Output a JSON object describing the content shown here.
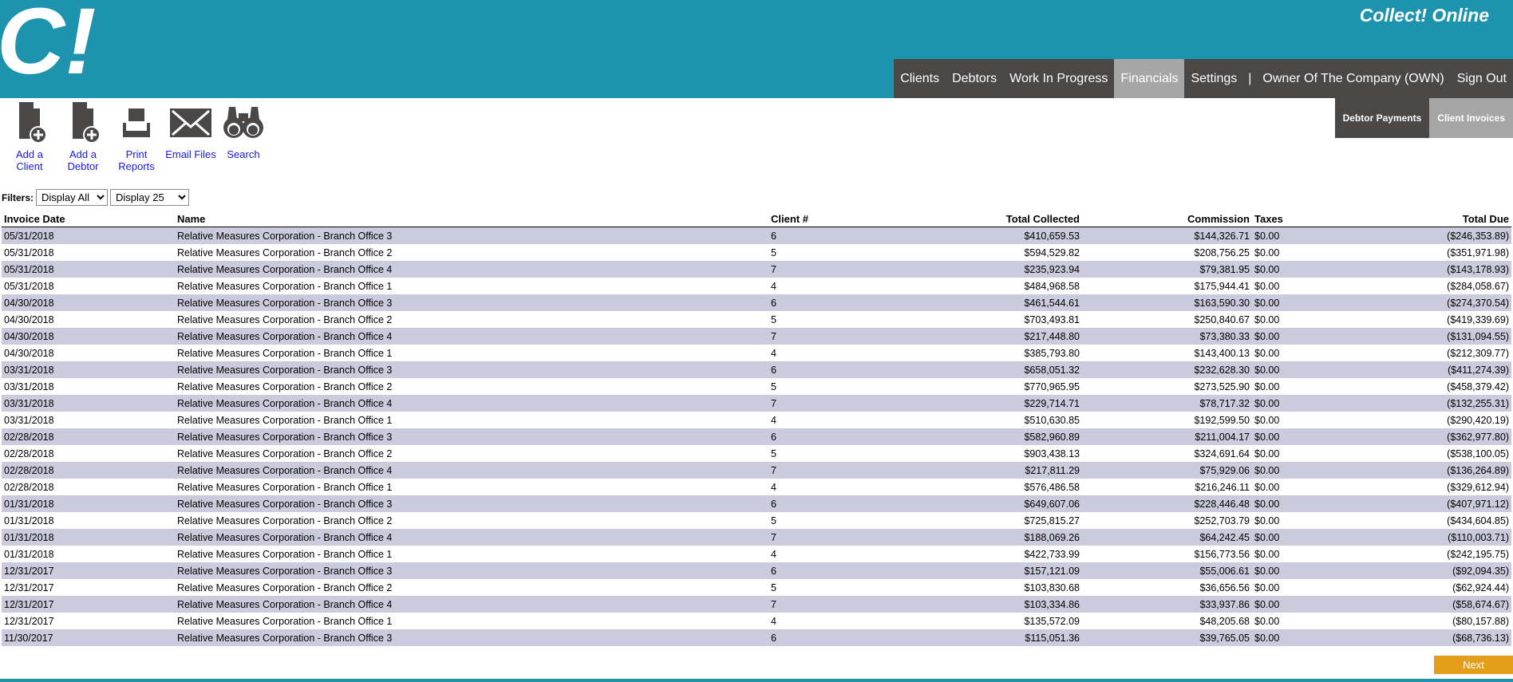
{
  "header": {
    "logo_text": "C!",
    "brand": "Collect! Online",
    "nav": [
      "Clients",
      "Debtors",
      "Work In Progress",
      "Financials",
      "Settings"
    ],
    "nav_separator": "|",
    "user": "Owner Of The Company (OWN)",
    "sign_out": "Sign Out",
    "active_nav": "Financials"
  },
  "toolbar": {
    "add_client": "Add a Client",
    "add_debtor": "Add a Debtor",
    "print_reports": "Print Reports",
    "email_files": "Email Files",
    "search": "Search"
  },
  "subnav": {
    "debtor_payments": "Debtor Payments",
    "client_invoices": "Client Invoices"
  },
  "filters": {
    "label": "Filters:",
    "display_filter": "Display All",
    "page_size": "Display 25"
  },
  "table": {
    "columns": [
      "Invoice Date",
      "Name",
      "Client #",
      "Total Collected",
      "Commission",
      "Taxes",
      "Total Due"
    ],
    "rows": [
      [
        "05/31/2018",
        "Relative Measures Corporation - Branch Office 3",
        "6",
        "$410,659.53",
        "$144,326.71",
        "$0.00",
        "($246,353.89)"
      ],
      [
        "05/31/2018",
        "Relative Measures Corporation - Branch Office 2",
        "5",
        "$594,529.82",
        "$208,756.25",
        "$0.00",
        "($351,971.98)"
      ],
      [
        "05/31/2018",
        "Relative Measures Corporation - Branch Office 4",
        "7",
        "$235,923.94",
        "$79,381.95",
        "$0.00",
        "($143,178.93)"
      ],
      [
        "05/31/2018",
        "Relative Measures Corporation - Branch Office 1",
        "4",
        "$484,968.58",
        "$175,944.41",
        "$0.00",
        "($284,058.67)"
      ],
      [
        "04/30/2018",
        "Relative Measures Corporation - Branch Office 3",
        "6",
        "$461,544.61",
        "$163,590.30",
        "$0.00",
        "($274,370.54)"
      ],
      [
        "04/30/2018",
        "Relative Measures Corporation - Branch Office 2",
        "5",
        "$703,493.81",
        "$250,840.67",
        "$0.00",
        "($419,339.69)"
      ],
      [
        "04/30/2018",
        "Relative Measures Corporation - Branch Office 4",
        "7",
        "$217,448.80",
        "$73,380.33",
        "$0.00",
        "($131,094.55)"
      ],
      [
        "04/30/2018",
        "Relative Measures Corporation - Branch Office 1",
        "4",
        "$385,793.80",
        "$143,400.13",
        "$0.00",
        "($212,309.77)"
      ],
      [
        "03/31/2018",
        "Relative Measures Corporation - Branch Office 3",
        "6",
        "$658,051.32",
        "$232,628.30",
        "$0.00",
        "($411,274.39)"
      ],
      [
        "03/31/2018",
        "Relative Measures Corporation - Branch Office 2",
        "5",
        "$770,965.95",
        "$273,525.90",
        "$0.00",
        "($458,379.42)"
      ],
      [
        "03/31/2018",
        "Relative Measures Corporation - Branch Office 4",
        "7",
        "$229,714.71",
        "$78,717.32",
        "$0.00",
        "($132,255.31)"
      ],
      [
        "03/31/2018",
        "Relative Measures Corporation - Branch Office 1",
        "4",
        "$510,630.85",
        "$192,599.50",
        "$0.00",
        "($290,420.19)"
      ],
      [
        "02/28/2018",
        "Relative Measures Corporation - Branch Office 3",
        "6",
        "$582,960.89",
        "$211,004.17",
        "$0.00",
        "($362,977.80)"
      ],
      [
        "02/28/2018",
        "Relative Measures Corporation - Branch Office 2",
        "5",
        "$903,438.13",
        "$324,691.64",
        "$0.00",
        "($538,100.05)"
      ],
      [
        "02/28/2018",
        "Relative Measures Corporation - Branch Office 4",
        "7",
        "$217,811.29",
        "$75,929.06",
        "$0.00",
        "($136,264.89)"
      ],
      [
        "02/28/2018",
        "Relative Measures Corporation - Branch Office 1",
        "4",
        "$576,486.58",
        "$216,246.11",
        "$0.00",
        "($329,612.94)"
      ],
      [
        "01/31/2018",
        "Relative Measures Corporation - Branch Office 3",
        "6",
        "$649,607.06",
        "$228,446.48",
        "$0.00",
        "($407,971.12)"
      ],
      [
        "01/31/2018",
        "Relative Measures Corporation - Branch Office 2",
        "5",
        "$725,815.27",
        "$252,703.79",
        "$0.00",
        "($434,604.85)"
      ],
      [
        "01/31/2018",
        "Relative Measures Corporation - Branch Office 4",
        "7",
        "$188,069.26",
        "$64,242.45",
        "$0.00",
        "($110,003.71)"
      ],
      [
        "01/31/2018",
        "Relative Measures Corporation - Branch Office 1",
        "4",
        "$422,733.99",
        "$156,773.56",
        "$0.00",
        "($242,195.75)"
      ],
      [
        "12/31/2017",
        "Relative Measures Corporation - Branch Office 3",
        "6",
        "$157,121.09",
        "$55,006.61",
        "$0.00",
        "($92,094.35)"
      ],
      [
        "12/31/2017",
        "Relative Measures Corporation - Branch Office 2",
        "5",
        "$103,830.68",
        "$36,656.56",
        "$0.00",
        "($62,924.44)"
      ],
      [
        "12/31/2017",
        "Relative Measures Corporation - Branch Office 4",
        "7",
        "$103,334.86",
        "$33,937.86",
        "$0.00",
        "($58,674.67)"
      ],
      [
        "12/31/2017",
        "Relative Measures Corporation - Branch Office 1",
        "4",
        "$135,572.09",
        "$48,205.68",
        "$0.00",
        "($80,157.88)"
      ],
      [
        "11/30/2017",
        "Relative Measures Corporation - Branch Office 3",
        "6",
        "$115,051.36",
        "$39,765.05",
        "$0.00",
        "($68,736.13)"
      ]
    ]
  },
  "pager": {
    "next": "Next"
  },
  "colors": {
    "header": "#1e93ad",
    "nav_bg": "#4a4747",
    "nav_active": "#a7a6a6",
    "row_stripe": "#cbcbdd",
    "link": "#1a1adc",
    "next_button": "#e59e19"
  },
  "icons": {
    "add_client": "document-plus-icon",
    "add_debtor": "document-plus-icon",
    "print_reports": "printer-icon",
    "email_files": "envelope-icon",
    "search": "binoculars-icon"
  }
}
